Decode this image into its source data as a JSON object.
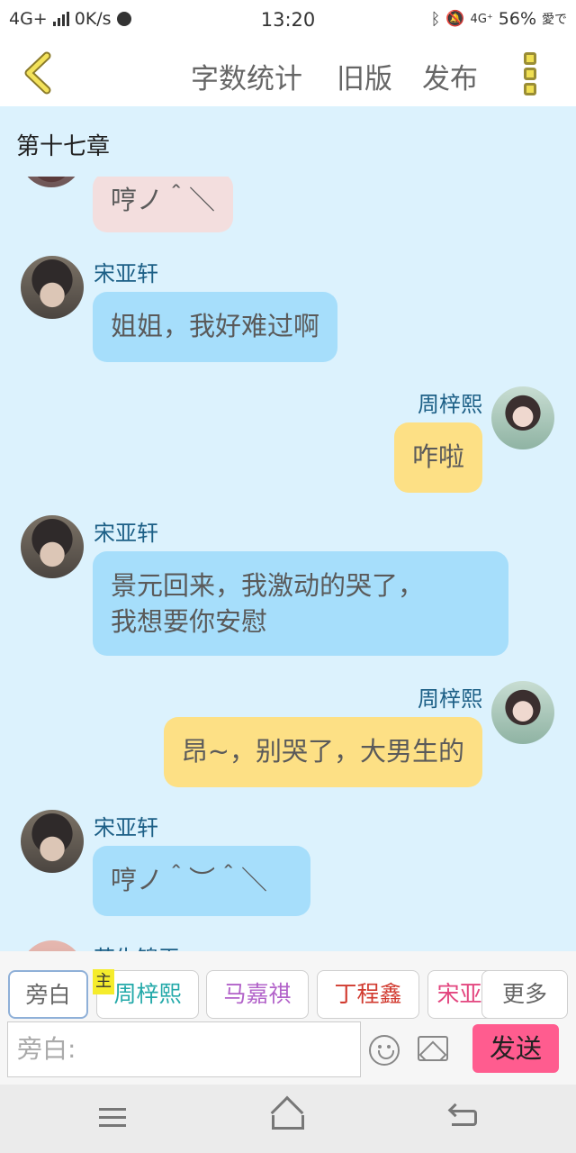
{
  "status_bar": {
    "network": "4G+",
    "speed": "0K/s",
    "time": "13:20",
    "network_right": "4G⁺",
    "battery": "56%",
    "carrier": "愛で"
  },
  "header": {
    "word_count": "字数统计",
    "old_version": "旧版",
    "publish": "发布"
  },
  "chapter": {
    "title": "第十七章"
  },
  "messages": [
    {
      "text": "哼ノ＾＼"
    },
    {
      "name": "宋亚轩",
      "text": "姐姐，我好难过啊"
    },
    {
      "name": "周梓熙",
      "text": "咋啦"
    },
    {
      "name": "宋亚轩",
      "line1": "景元回来，我激动的哭了，",
      "line2": "我想要你安慰"
    },
    {
      "name": "周梓熙",
      "text": "昂~，别哭了，大男生的"
    },
    {
      "name": "宋亚轩",
      "text": "哼ノ＾︶＾＼"
    },
    {
      "name": "苏生锦玉"
    }
  ],
  "roles": {
    "narration": "旁白",
    "host_badge": "主",
    "zhou": "周梓熙",
    "ma": "马嘉祺",
    "ding": "丁程鑫",
    "song": "宋亚",
    "more": "更多"
  },
  "role_colors": {
    "zhou": "#23a9a9",
    "ma": "#b262c9",
    "ding": "#d13a2f",
    "song": "#e3467f"
  },
  "input": {
    "placeholder": "旁白:"
  },
  "send_label": "发送"
}
